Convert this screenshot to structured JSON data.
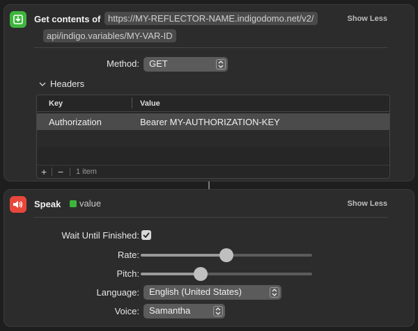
{
  "get_contents": {
    "title": "Get contents of",
    "url_line1": "https://MY-REFLECTOR-NAME.indigodomo.net/v2/",
    "url_line2": "api/indigo.variables/MY-VAR-ID",
    "show_less": "Show Less",
    "method_label": "Method:",
    "method_value": "GET",
    "headers_label": "Headers",
    "table": {
      "columns": [
        "Key",
        "Value"
      ],
      "rows": [
        {
          "key": "Authorization",
          "value": "Bearer MY-AUTHORIZATION-KEY"
        }
      ],
      "add_symbol": "+",
      "remove_symbol": "−",
      "item_count": "1 item"
    }
  },
  "speak": {
    "title": "Speak",
    "variable_token": "value",
    "show_less": "Show Less",
    "wait_label": "Wait Until Finished:",
    "wait_checked": true,
    "rate_label": "Rate:",
    "rate_value": 0.5,
    "pitch_label": "Pitch:",
    "pitch_value": 0.35,
    "language_label": "Language:",
    "language_value": "English (United States)",
    "voice_label": "Voice:",
    "voice_value": "Samantha"
  },
  "colors": {
    "get_icon_bg": "#3db53d",
    "speak_icon_bg": "#e8473c",
    "variable_token_color": "#3db53d"
  },
  "icons": {
    "get_contents": "download-tray-icon",
    "speak": "speaker-icon",
    "popup": "chevron-up-down-icon",
    "disclosure": "chevron-down-icon",
    "checkbox": "checkmark-icon"
  }
}
